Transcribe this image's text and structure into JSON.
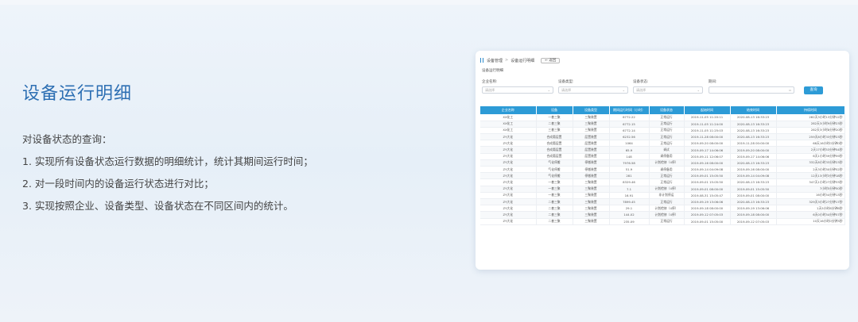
{
  "title": "设备运行明细",
  "description": {
    "intro": "对设备状态的查询：",
    "points": [
      "1. 实现所有设备状态运行数据的明细统计，统计其期间运行时间；",
      "2. 对一段时间内的设备运行状态进行对比；",
      "3. 实现按照企业、设备类型、设备状态在不同区间内的统计。"
    ]
  },
  "screenshot": {
    "breadcrumb": [
      "设备管理",
      "设备运行明细"
    ],
    "breadcrumb_sep": ">",
    "back_label": "← 返回",
    "subtitle": "设备运行明细",
    "filters": [
      {
        "label": "企业名称:",
        "placeholder": "请选择"
      },
      {
        "label": "设备类型:",
        "placeholder": "请选择"
      },
      {
        "label": "设备状态:",
        "placeholder": "请选择"
      },
      {
        "label": "期间:",
        "placeholder": ""
      }
    ],
    "search_label": "查询",
    "accent": "#2d9bd6",
    "columns": [
      "企业名称",
      "设备",
      "设备类型",
      "期间运行时间（小时）",
      "设备状态",
      "起始时间",
      "结束时间",
      "持续时间"
    ],
    "rows": [
      [
        "XX化工",
        "一套三聚",
        "三聚装置",
        "6772.22",
        "正常运行",
        "2019-11-05 11:20:11",
        "2020-08-13 16:33:23",
        "282天3小时13分钟12秒"
      ],
      [
        "XX化工",
        "二套三聚",
        "三聚装置",
        "6772.15",
        "正常运行",
        "2019-11-05 11:24:00",
        "2020-08-13 16:33:23",
        "282天3小时9分钟23秒"
      ],
      [
        "XX化工",
        "三套三聚",
        "三聚装置",
        "6772.14",
        "正常运行",
        "2019-11-05 11:25:03",
        "2020-08-13 16:33:23",
        "282天3小时8分钟20秒"
      ],
      [
        "ZY大化",
        "合成氨层置",
        "层置装置",
        "6232.56",
        "正常运行",
        "2019-11-28 08:00:00",
        "2020-08-13 16:33:23",
        "259天8小时33分钟23秒"
      ],
      [
        "ZY大化",
        "合成氨层置",
        "层置装置",
        "1064",
        "正常运行",
        "2019-09-20 08:00:00",
        "2019-11-28 00:00:00",
        "68天16小时0分钟0秒"
      ],
      [
        "ZY大化",
        "合成氨层置",
        "层置装置",
        "65.9",
        "调试",
        "2019-09-17 14:06:06",
        "2019-09-20 08:00:00",
        "2天17小时53分钟54秒"
      ],
      [
        "ZY大化",
        "合成氨层置",
        "层置装置",
        "148",
        "调停备用",
        "2019-09-11 12:06:07",
        "2019-09-17 14:06:06",
        "6天1小时59分钟59秒"
      ],
      [
        "ZY大化",
        "气化停搬",
        "停搬装置",
        "7976.58",
        "计划检修（4停）",
        "2019-09-16 08:00:00",
        "2020-08-13 16:33:23",
        "332天8小时33分钟23秒"
      ],
      [
        "ZY大化",
        "气化停搬",
        "停搬装置",
        "51.9",
        "调停备用",
        "2019-09-14 04:09:08",
        "2019-09-16 08:00:00",
        "2天3小时50分钟52秒"
      ],
      [
        "ZY大化",
        "气化停搬",
        "停搬装置",
        "281",
        "正常运行",
        "2019-09-01 15:05:50",
        "2019-09-14 04:09:08",
        "12天13小时3分钟18秒"
      ],
      [
        "ZY大化",
        "一套三聚",
        "三聚装置",
        "8329.46",
        "正常运行",
        "2019-09-01 15:05:50",
        "2020-08-13 16:33:23",
        "347天1小时27分钟33秒"
      ],
      [
        "ZY大化",
        "一套三聚",
        "三聚装置",
        "7.1",
        "计划检修（4停）",
        "2019-09-01 08:00:00",
        "2019-09-01 15:05:50",
        "7小时5分钟50秒"
      ],
      [
        "ZY大化",
        "一套三聚",
        "三聚装置",
        "16.91",
        "非计划停运",
        "2019-08-31 15:05:47",
        "2019-09-01 08:00:00",
        "16小时54分钟13秒"
      ],
      [
        "ZY大化",
        "二套三聚",
        "三聚装置",
        "7899.45",
        "正常运行",
        "2019-09-19 13:06:06",
        "2020-08-13 16:33:23",
        "329天3小时27分钟17秒"
      ],
      [
        "ZY大化",
        "二套三聚",
        "三聚装置",
        "29.1",
        "计划检修（4停）",
        "2019-09-18 08:00:00",
        "2019-09-19 13:06:06",
        "1天5小时6分钟6秒"
      ],
      [
        "ZY大化",
        "二套三聚",
        "三聚装置",
        "144.02",
        "计划检修（4停）",
        "2019-09-12 07:05:03",
        "2019-09-18 08:00:00",
        "6天0小时54分钟57秒"
      ],
      [
        "ZY大化",
        "二套三聚",
        "三聚装置",
        "235.09",
        "正常运行",
        "2019-09-01 15:05:00",
        "2019-09-12 07:05:03",
        "10天16小时0分钟3秒"
      ]
    ]
  }
}
